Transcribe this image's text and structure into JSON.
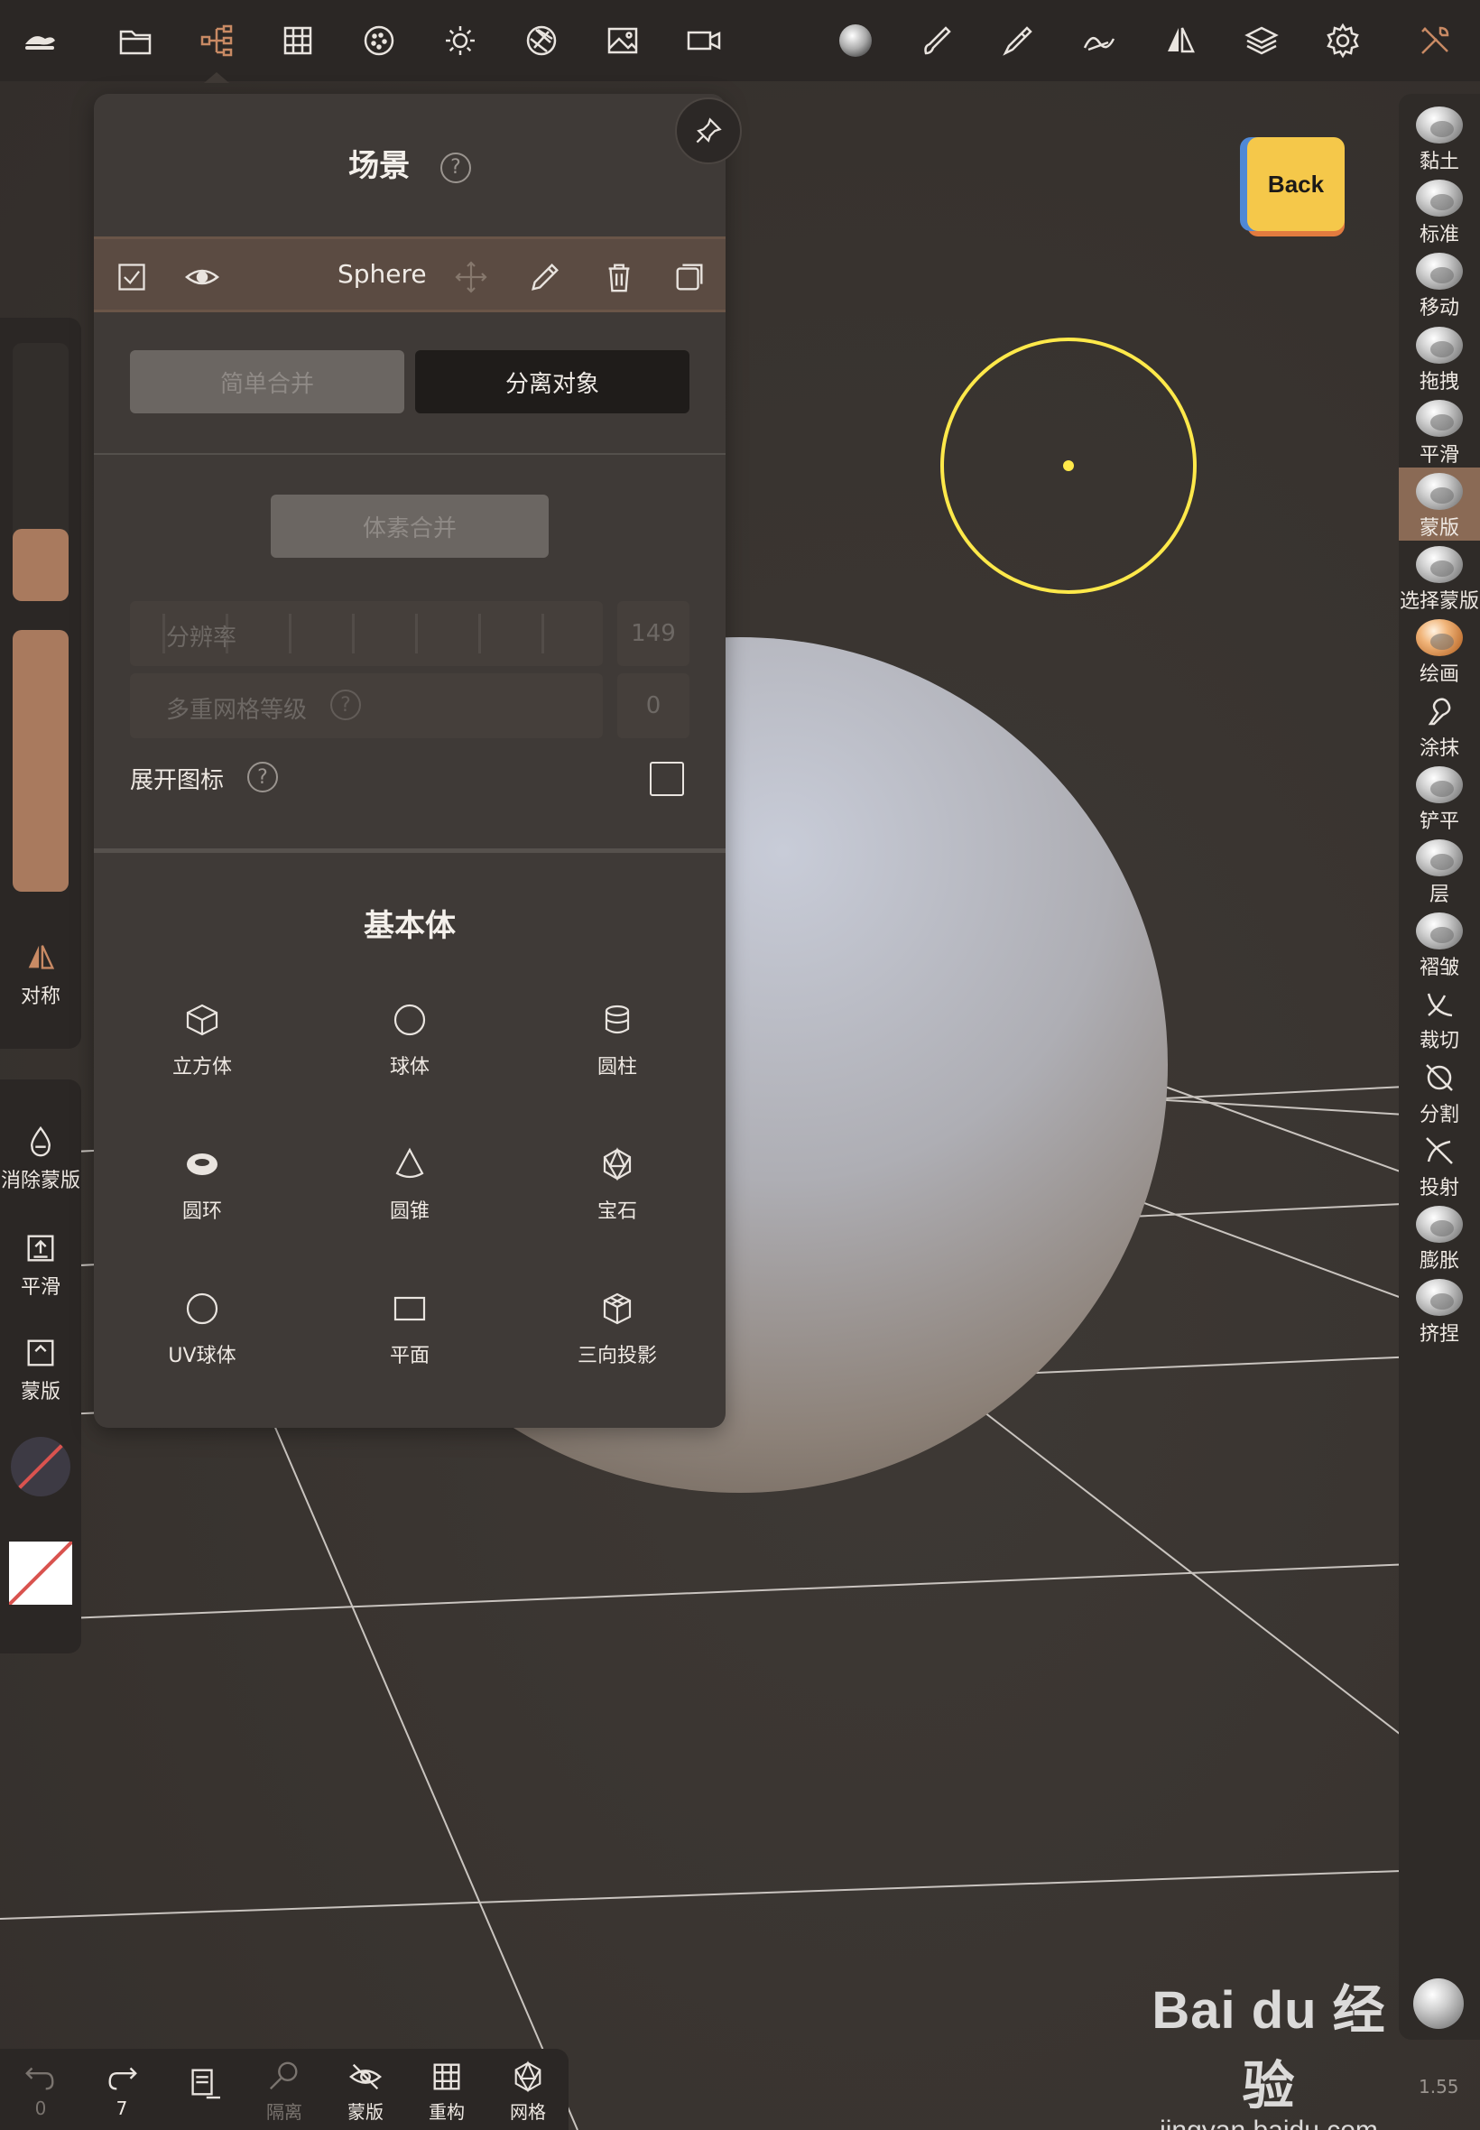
{
  "top_toolbar": {
    "icons": [
      "nomad-logo-icon",
      "folder-icon",
      "scene-tree-icon",
      "grid-icon",
      "material-icon",
      "light-icon",
      "aperture-icon",
      "image-icon",
      "camera-icon",
      "matcap-ball-icon",
      "brush-icon",
      "dropper-icon",
      "stroke-icon",
      "symmetry-icon",
      "layers-icon",
      "settings-icon",
      "tools-icon"
    ],
    "accent_color": "#c98a64"
  },
  "scene_panel": {
    "title": "场景",
    "help": "?",
    "object": {
      "name": "Sphere",
      "checked": true,
      "visible": true
    },
    "buttons": {
      "simple_merge": "简单合并",
      "separate": "分离对象",
      "voxel_merge": "体素合并"
    },
    "resolution": {
      "label": "分辨率",
      "value": "149"
    },
    "multires": {
      "label": "多重网格等级",
      "help": "?",
      "value": "0"
    },
    "expand_icons": {
      "label": "展开图标",
      "help": "?",
      "checked": false
    },
    "primitives_title": "基本体",
    "primitives": [
      "立方体",
      "球体",
      "圆柱",
      "圆环",
      "圆锥",
      "宝石",
      "UV球体",
      "平面",
      "三向投影"
    ]
  },
  "back_cube": {
    "label": "Back"
  },
  "right_tools": [
    {
      "label": "黏土",
      "kind": "ball"
    },
    {
      "label": "标准",
      "kind": "ball"
    },
    {
      "label": "移动",
      "kind": "ball"
    },
    {
      "label": "拖拽",
      "kind": "ball"
    },
    {
      "label": "平滑",
      "kind": "ball"
    },
    {
      "label": "蒙版",
      "kind": "ball",
      "active": true
    },
    {
      "label": "选择蒙版",
      "kind": "ball"
    },
    {
      "label": "绘画",
      "kind": "paint"
    },
    {
      "label": "涂抹",
      "kind": "glyph"
    },
    {
      "label": "铲平",
      "kind": "ball"
    },
    {
      "label": "层",
      "kind": "ball"
    },
    {
      "label": "褶皱",
      "kind": "ball"
    },
    {
      "label": "裁切",
      "kind": "glyph"
    },
    {
      "label": "分割",
      "kind": "glyph"
    },
    {
      "label": "投射",
      "kind": "glyph"
    },
    {
      "label": "膨胀",
      "kind": "ball"
    },
    {
      "label": "挤捏",
      "kind": "ball"
    }
  ],
  "left_panel": {
    "radius_fraction": 0.28,
    "intensity_fraction": 1.0,
    "symmetry_label": "对称",
    "mask_tools": {
      "clear": "消除蒙版",
      "smooth": "平滑",
      "mask": "蒙版"
    }
  },
  "bottom_bar": {
    "undo_count": "0",
    "redo_count": "7",
    "isolate": "隔离",
    "mask": "蒙版",
    "remesh": "重构",
    "wireframe": "网格"
  },
  "version": "1.55",
  "watermark": {
    "brand": "Bai du 经验",
    "url": "jingyan.baidu.com"
  }
}
